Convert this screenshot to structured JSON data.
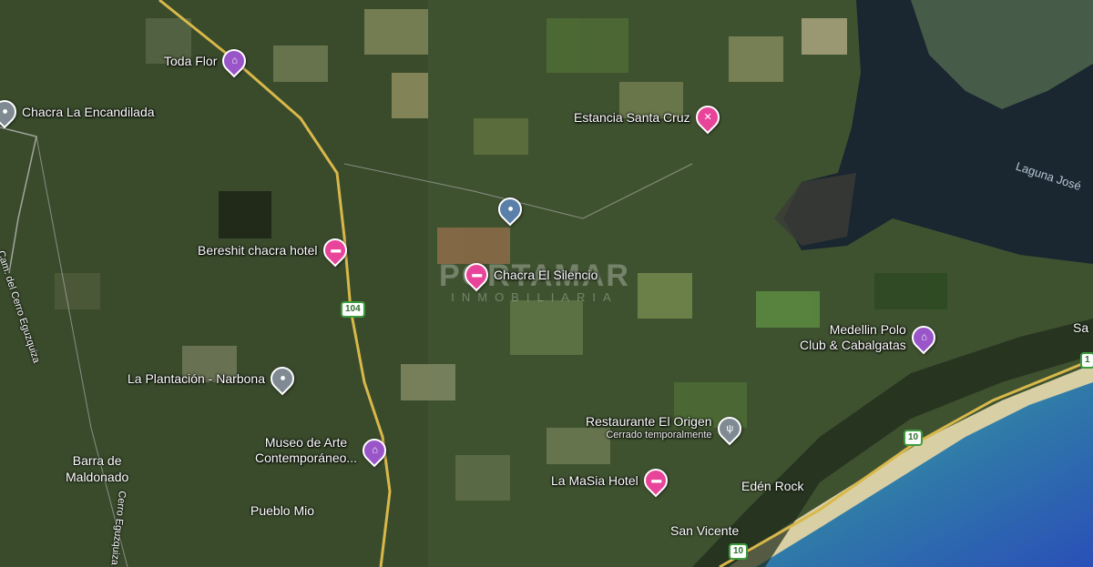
{
  "places": {
    "toda_flor": "Toda Flor",
    "chacra_encandilada": "Chacra La Encandilada",
    "estancia_santa_cruz": "Estancia Santa Cruz",
    "laguna": "Laguna José",
    "bereshit": "Bereshit chacra hotel",
    "chacra_silencio": "Chacra El Silencio",
    "medellin_polo_1": "Medellin Polo",
    "medellin_polo_2": "Club & Cabalgatas",
    "la_plantacion": "La Plantación - Narbona",
    "restaurante_origen": "Restaurante El Origen",
    "restaurante_status": "Cerrado temporalmente",
    "museo_1": "Museo de Arte",
    "museo_2": "Contemporáneo...",
    "barra_1": "Barra de",
    "barra_2": "Maldonado",
    "la_masia": "La MaSia Hotel",
    "eden_rock": "Edén Rock",
    "pueblo_mio": "Pueblo Mio",
    "san_vicente": "San Vicente",
    "sa_partial": "Sa",
    "cam_cerro": "Cam. del Cerro Eguzquiza",
    "cerro_eguzquiza": "Cerro Eguzquiza"
  },
  "roads": {
    "r104": "104",
    "r10a": "10",
    "r10b": "10"
  },
  "watermark": {
    "line1": "PORTAMAR",
    "line2": "INMOBILIARIA"
  },
  "icons": {
    "hotel": "bed-icon",
    "attraction": "landmark-icon",
    "restaurant": "fork-knife-icon",
    "generic": "pin-icon",
    "farm": "tools-icon"
  },
  "colors": {
    "hotel_pin": "#e8449a",
    "attraction_pin": "#9a56c9",
    "generic_pin": "#7f8a93",
    "road": "#d9b84a",
    "lagoon": "#1a2630",
    "ocean": "#3e8ab0"
  }
}
